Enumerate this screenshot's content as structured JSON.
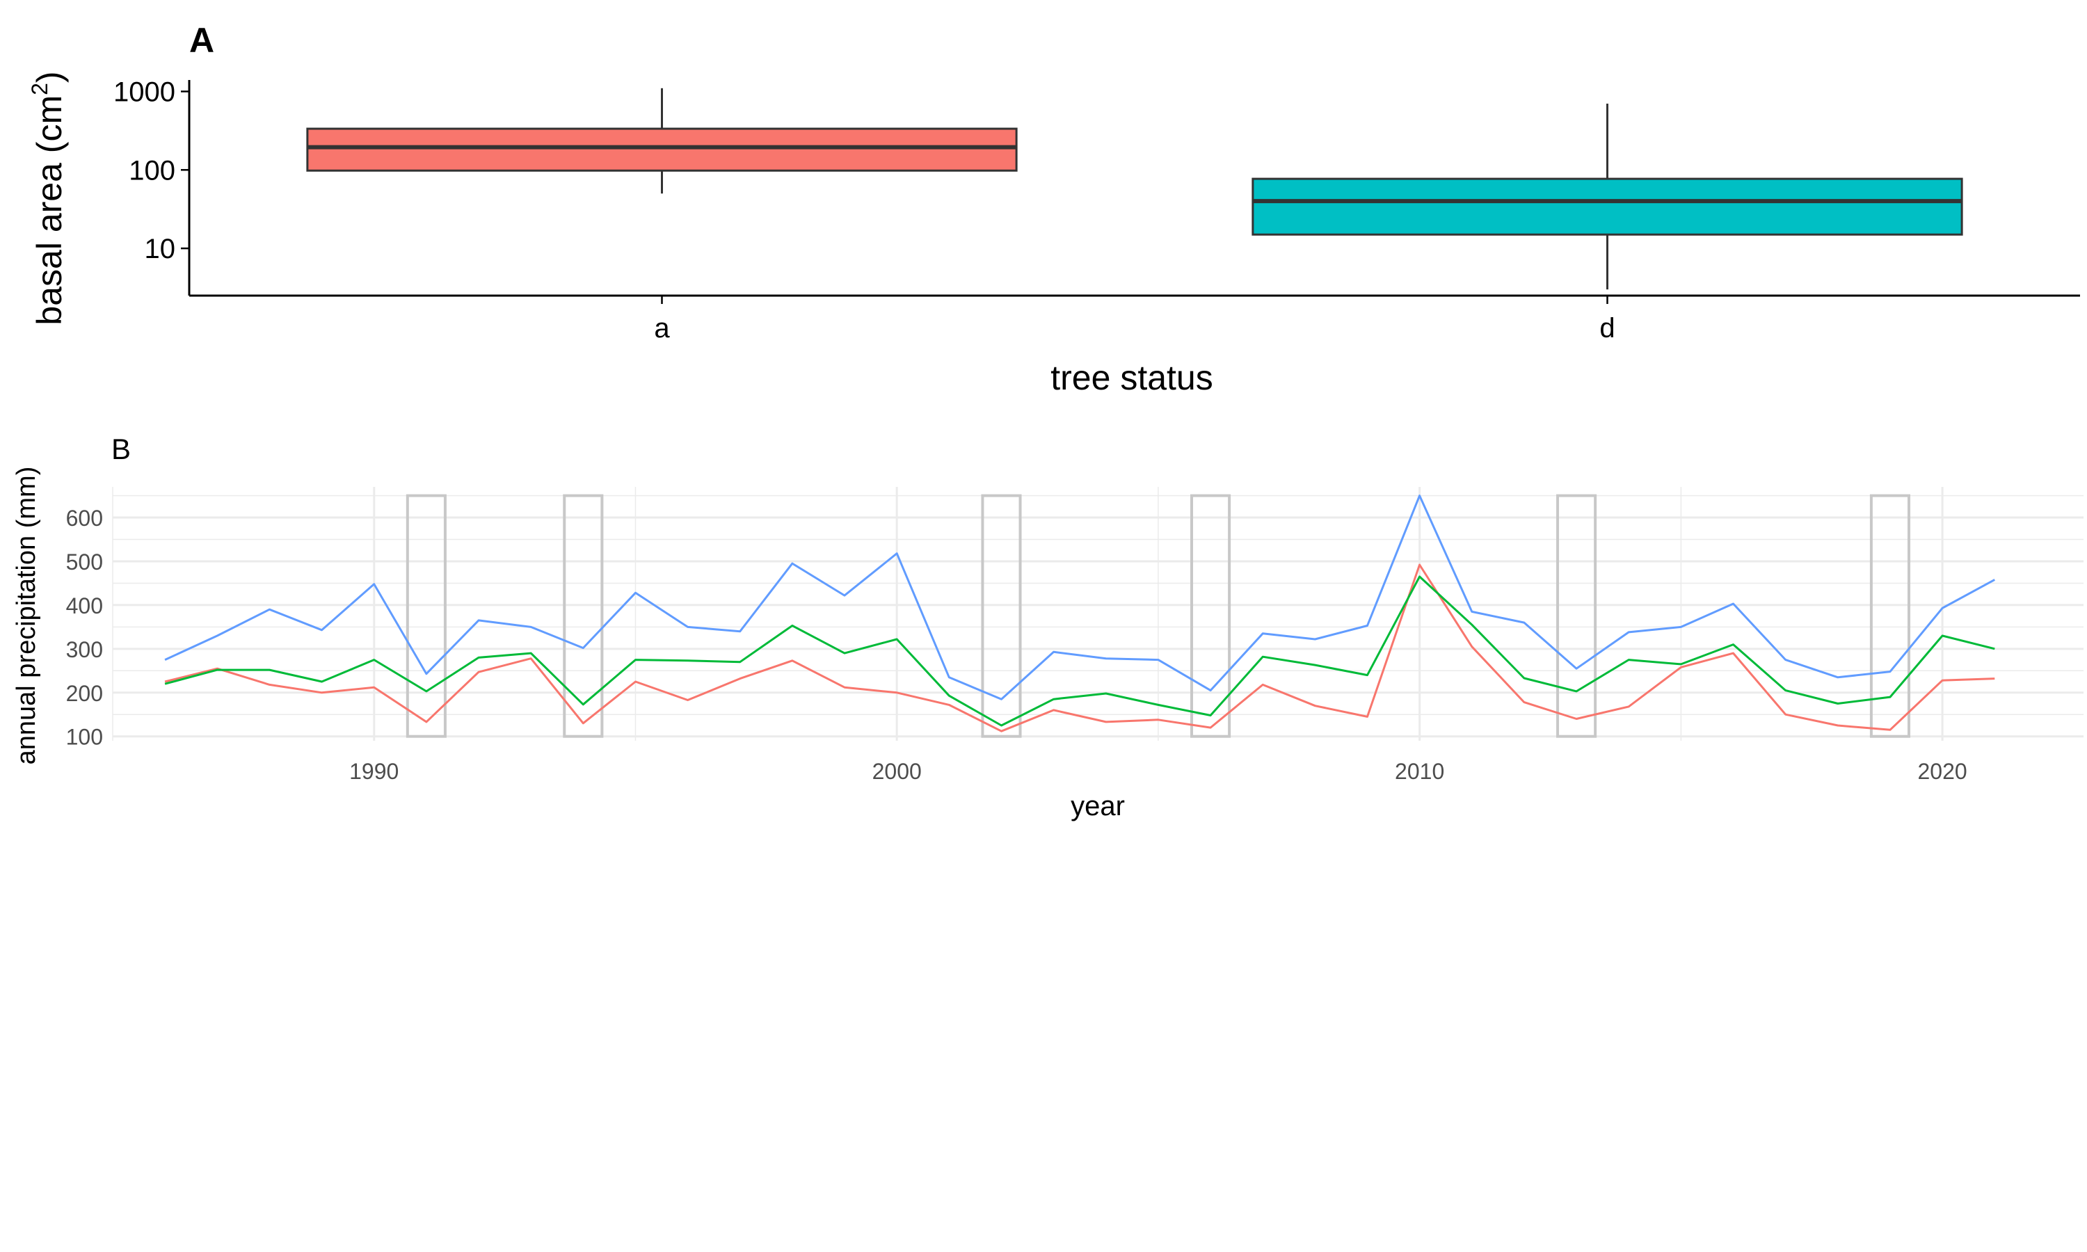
{
  "colors": {
    "box_a": "#F8766D",
    "box_d": "#00BFC4",
    "line_red": "#F8766D",
    "line_green": "#00BA38",
    "line_blue": "#619CFF",
    "highlight": "#C8C8C8",
    "grid": "#EBEBEB"
  },
  "chart_data": [
    {
      "panel": "A",
      "type": "box",
      "xlabel": "tree status",
      "ylabel_main": "basal area (cm",
      "ylabel_sup": "2",
      "ylabel_end": ")",
      "y_scale": "log10",
      "ylim": [
        2.5,
        1400
      ],
      "yticks": [
        10,
        100,
        1000
      ],
      "ytick_labels": [
        "10",
        "100",
        "1000"
      ],
      "grid": false,
      "boxes": [
        {
          "category": "a",
          "whisker_low": 50,
          "q1": 98,
          "median": 195,
          "q3": 335,
          "whisker_high": 1100,
          "color_key": "box_a"
        },
        {
          "category": "d",
          "whisker_low": 3,
          "q1": 15,
          "median": 40,
          "q3": 77,
          "whisker_high": 700,
          "color_key": "box_d"
        }
      ]
    },
    {
      "panel": "B",
      "type": "line",
      "xlabel": "year",
      "ylabel": "annual precipitation (mm)",
      "xlim": [
        1985,
        2022.7
      ],
      "ylim": [
        90,
        670
      ],
      "xticks": [
        1990,
        2000,
        2010,
        2020
      ],
      "xtick_labels": [
        "1990",
        "2000",
        "2010",
        "2020"
      ],
      "yticks": [
        100,
        200,
        300,
        400,
        500,
        600
      ],
      "ytick_labels": [
        "100",
        "200",
        "300",
        "400",
        "500",
        "600"
      ],
      "grid": true,
      "highlight_years": [
        1991,
        1994,
        2002,
        2006,
        2013,
        2019
      ],
      "highlight_range": [
        100,
        650
      ],
      "x": [
        1986,
        1987,
        1988,
        1989,
        1990,
        1991,
        1992,
        1993,
        1994,
        1995,
        1996,
        1997,
        1998,
        1999,
        2000,
        2001,
        2002,
        2003,
        2004,
        2005,
        2006,
        2007,
        2008,
        2009,
        2010,
        2011,
        2012,
        2013,
        2014,
        2015,
        2016,
        2017,
        2018,
        2019,
        2020,
        2021
      ],
      "series": [
        {
          "color_key": "line_red",
          "values": [
            225,
            255,
            218,
            200,
            212,
            133,
            247,
            278,
            130,
            225,
            183,
            232,
            273,
            212,
            200,
            172,
            112,
            160,
            133,
            138,
            120,
            218,
            170,
            145,
            492,
            305,
            178,
            140,
            168,
            258,
            290,
            150,
            125,
            115,
            228,
            232
          ]
        },
        {
          "color_key": "line_green",
          "values": [
            220,
            252,
            252,
            225,
            275,
            203,
            280,
            290,
            173,
            275,
            273,
            270,
            353,
            290,
            322,
            193,
            125,
            185,
            198,
            172,
            148,
            282,
            263,
            240,
            465,
            355,
            233,
            203,
            275,
            265,
            310,
            205,
            175,
            190,
            330,
            300
          ]
        },
        {
          "color_key": "line_blue",
          "values": [
            275,
            330,
            390,
            343,
            448,
            243,
            365,
            350,
            302,
            428,
            350,
            340,
            495,
            422,
            518,
            235,
            185,
            293,
            278,
            275,
            205,
            335,
            322,
            353,
            650,
            385,
            360,
            255,
            338,
            350,
            403,
            275,
            235,
            248,
            393,
            458
          ]
        }
      ]
    }
  ],
  "panel_a": {
    "tag": "A",
    "xlabel": "tree status",
    "ylabel_main": "basal area (cm",
    "ylabel_sup": "2",
    "ylabel_end": ")"
  },
  "panel_b": {
    "tag": "B",
    "xlabel": "year",
    "ylabel": "annual precipitation (mm)"
  }
}
